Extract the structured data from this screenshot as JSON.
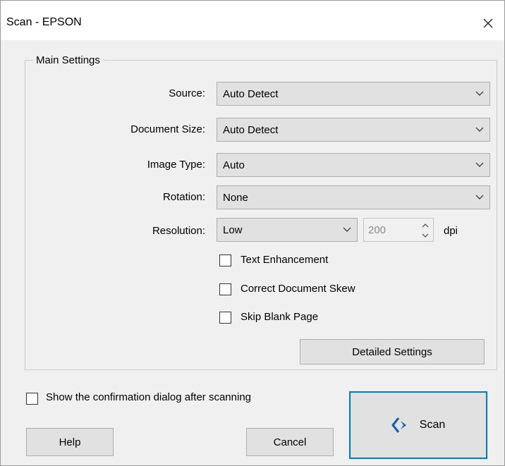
{
  "window": {
    "title": "Scan - EPSON"
  },
  "main_settings": {
    "legend": "Main Settings",
    "source": {
      "label": "Source:",
      "value": "Auto Detect"
    },
    "document_size": {
      "label": "Document Size:",
      "value": "Auto Detect"
    },
    "image_type": {
      "label": "Image Type:",
      "value": "Auto"
    },
    "rotation": {
      "label": "Rotation:",
      "value": "None"
    },
    "resolution": {
      "label": "Resolution:",
      "value": "Low",
      "dpi_value": "200",
      "unit": "dpi"
    },
    "text_enhancement": {
      "label": "Text Enhancement",
      "checked": false
    },
    "correct_skew": {
      "label": "Correct Document Skew",
      "checked": false
    },
    "skip_blank": {
      "label": "Skip Blank Page",
      "checked": false
    },
    "detailed_settings_label": "Detailed Settings"
  },
  "footer": {
    "confirmation_label": "Show the confirmation dialog after scanning",
    "help_label": "Help",
    "cancel_label": "Cancel",
    "scan_label": "Scan"
  },
  "colors": {
    "accent": "#0078d7",
    "scan_icon": "#1a5fb4"
  }
}
